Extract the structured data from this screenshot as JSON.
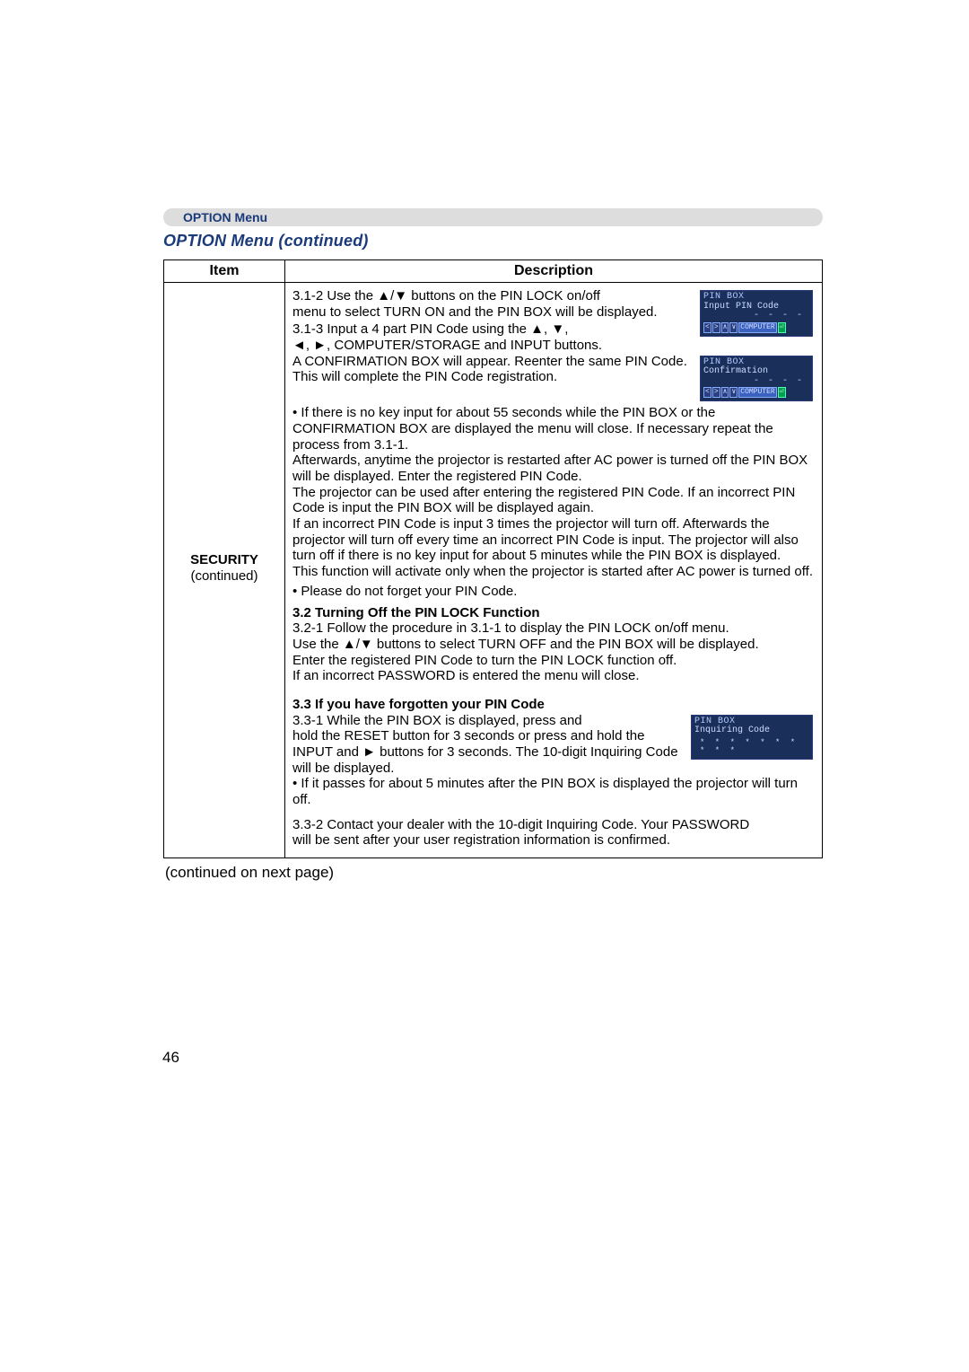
{
  "menuBarLabel": "OPTION Menu",
  "sectionTitle": "OPTION Menu (continued)",
  "headers": {
    "item": "Item",
    "desc": "Description"
  },
  "item": {
    "name": "SECURITY",
    "sub": "(continued)"
  },
  "desc": {
    "s312a": "3.1-2 Use the ▲/▼ buttons on the PIN LOCK on/off",
    "s312b": "menu to select TURN ON and the PIN BOX will be displayed.",
    "s313a": "3.1-3   Input a 4 part PIN Code using the ▲, ▼,",
    "s313b": "◄, ►, COMPUTER/STORAGE and INPUT buttons.",
    "confBox": "A CONFIRMATION BOX will appear. Reenter the same PIN Code. This will complete the PIN Code registration.",
    "noKey": "• If there is no key input for about 55 seconds while the PIN BOX or the CONFIRMATION BOX are displayed the menu will close. If necessary repeat the process from 3.1-1.",
    "afterwards": "Afterwards, anytime the projector is restarted after AC power is turned off the PIN BOX will be displayed. Enter the registered PIN Code.",
    "usedAfter": "The projector can be used after entering the registered PIN Code. If an incorrect PIN Code is input the PIN BOX will be displayed again.",
    "incorrect3": "If an incorrect PIN Code is input 3 times the projector will turn off. Afterwards the projector will turn off every time an incorrect PIN Code is input. The projector will also turn off if there is no key input for about 5 minutes while the PIN BOX is displayed.",
    "activate": "This function will activate only when the projector is started after AC power is turned off.",
    "forget": "• Please do not forget your PIN Code.",
    "h32": "3.2 Turning Off the PIN LOCK Function",
    "s321a": "3.2-1 Follow the procedure in 3.1-1 to display the PIN LOCK on/off menu.",
    "s321b": "Use the ▲/▼ buttons to select TURN OFF and the PIN BOX will be displayed.",
    "enterReg": "Enter the registered PIN Code to turn the PIN LOCK function off.",
    "wrongPass": "If an incorrect PASSWORD is entered the menu will close.",
    "h33": "3.3 If you have forgotten your PIN Code",
    "s331a": "3.3-1 While the PIN BOX is displayed, press and",
    "s331b": "hold the RESET button for 3 seconds or press and hold the INPUT and ► buttons for 3 seconds. The 10-digit Inquiring Code will be displayed.",
    "pass5": "• If it passes for about 5 minutes after the PIN BOX is displayed the projector will turn off.",
    "s332": "3.3-2 Contact your dealer with the 10-digit Inquiring Code. Your PASSWORD",
    "s332b": "will be sent after your user registration information is confirmed."
  },
  "pinbox1": {
    "title": "PIN BOX",
    "line": "Input PIN Code",
    "dashes": "- - - -"
  },
  "pinbox2": {
    "title": "PIN BOX",
    "line": "Confirmation",
    "dashes": "- - - -"
  },
  "pinbox3": {
    "title": "PIN BOX",
    "line": "Inquiring Code",
    "stars": "* *  * * * *  * * * *"
  },
  "keys": {
    "l": "<",
    "r": ">",
    "u": "∧",
    "d": "∨",
    "comp": "COMPUTER",
    "ent": "⏎"
  },
  "continued": "(continued on next page)",
  "pageNum": "46"
}
